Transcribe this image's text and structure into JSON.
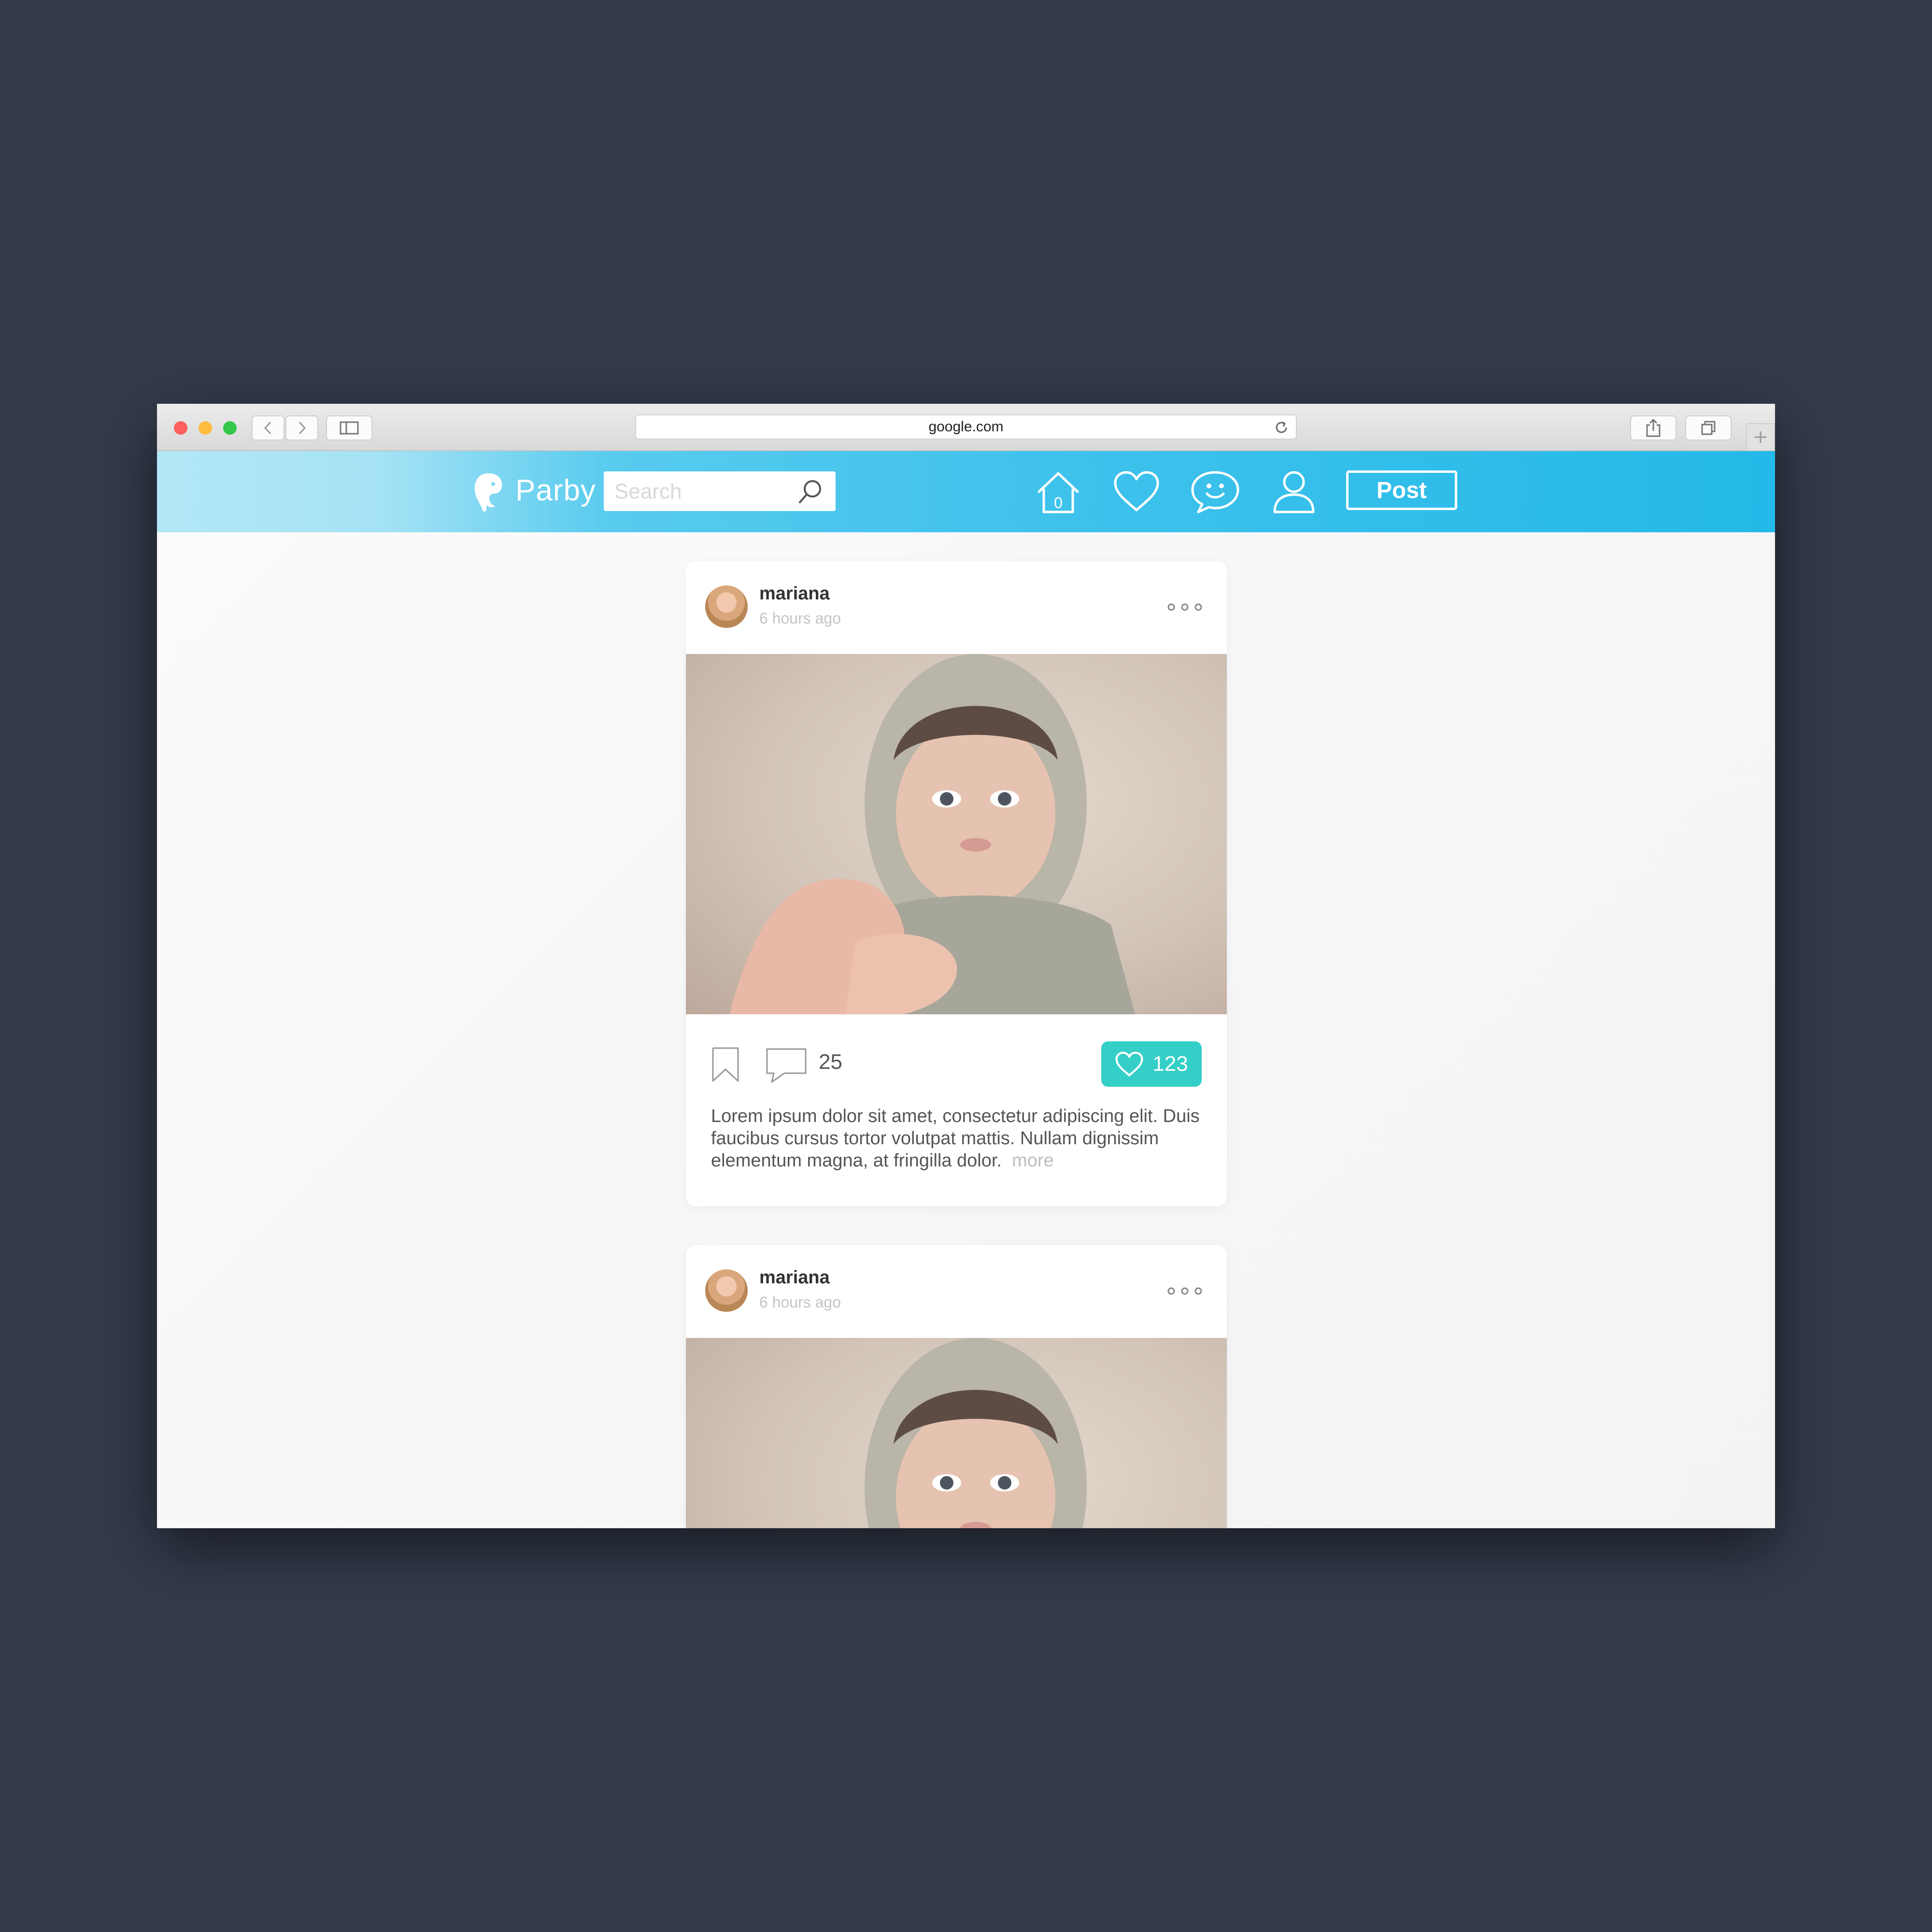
{
  "browser": {
    "url": "google.com"
  },
  "app": {
    "brand": "Parby",
    "search_placeholder": "Search",
    "home_badge": "0",
    "post_label": "Post"
  },
  "posts": [
    {
      "username": "mariana",
      "time": "6 hours ago",
      "comments": "25",
      "likes": "123",
      "caption": "Lorem ipsum dolor sit amet, consectetur adipiscing elit. Duis faucibus cursus tortor volutpat mattis. Nullam dignissim elementum magna, at fringilla dolor.",
      "more_label": "more"
    },
    {
      "username": "mariana",
      "time": "6 hours ago"
    }
  ],
  "colors": {
    "accent": "#24b9e8",
    "like": "#34cfc6",
    "background": "#333b4b"
  }
}
